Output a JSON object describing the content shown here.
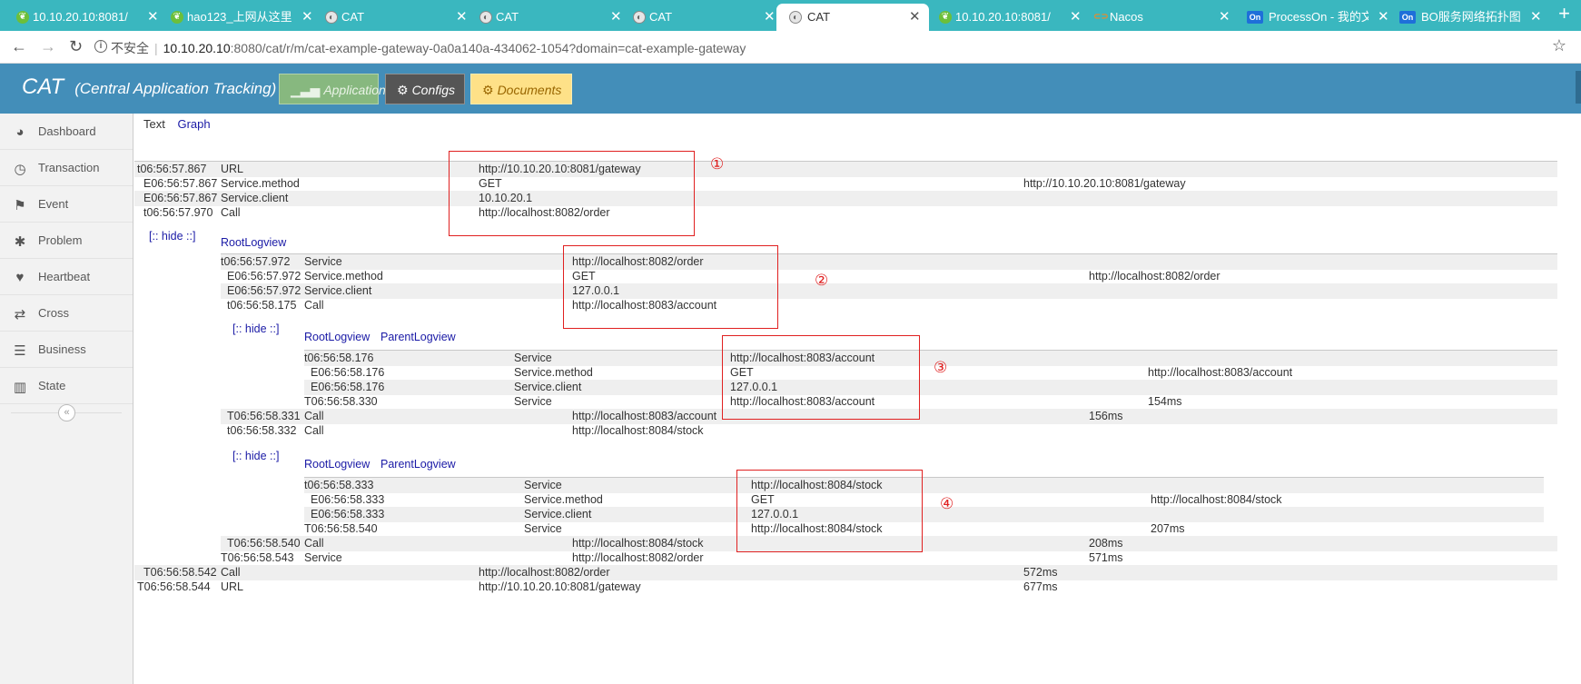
{
  "browser": {
    "tabs": [
      {
        "label": "10.10.20.10:8081/",
        "icon": "leaf-icon"
      },
      {
        "label": "hao123_上网从这里",
        "icon": "leaf-icon"
      },
      {
        "label": "CAT",
        "icon": "cat-icon"
      },
      {
        "label": "CAT",
        "icon": "cat-icon"
      },
      {
        "label": "CAT",
        "icon": "cat-icon"
      },
      {
        "label": "CAT",
        "icon": "cat-icon"
      },
      {
        "label": "10.10.20.10:8081/",
        "icon": "leaf-icon"
      },
      {
        "label": "Nacos",
        "icon": "nacos-icon"
      },
      {
        "label": "ProcessOn - 我的文",
        "icon": "processon-icon"
      },
      {
        "label": "BO服务网络拓扑图",
        "icon": "processon-icon"
      }
    ],
    "active_tab": 5,
    "new_tab": "+",
    "address": {
      "insecure_label": "不安全",
      "separator": "|",
      "host": "10.10.20.10",
      "path": ":8080/cat/r/m/cat-example-gateway-0a0a140a-434062-1054?domain=cat-example-gateway"
    }
  },
  "header": {
    "brand": "CAT",
    "subtitle": "(Central Application Tracking)",
    "buttons": {
      "application": "Application",
      "configs": "Configs",
      "documents": "Documents"
    }
  },
  "sidebar": {
    "items": [
      {
        "label": "Dashboard",
        "icon": "dashboard-icon"
      },
      {
        "label": "Transaction",
        "icon": "clock-icon"
      },
      {
        "label": "Event",
        "icon": "flag-icon"
      },
      {
        "label": "Problem",
        "icon": "bug-icon"
      },
      {
        "label": "Heartbeat",
        "icon": "heart-icon"
      },
      {
        "label": "Cross",
        "icon": "shuffle-icon"
      },
      {
        "label": "Business",
        "icon": "list-icon"
      },
      {
        "label": "State",
        "icon": "bar-chart-icon"
      }
    ],
    "collapse": "«"
  },
  "view_tabs": {
    "text": "Text",
    "graph": "Graph"
  },
  "trace": {
    "l0": [
      {
        "time": "t06:56:57.867",
        "type": "URL",
        "name": "http://10.10.20.10:8081/gateway",
        "extra": ""
      },
      {
        "time": "E06:56:57.867",
        "type": "Service.method",
        "name": "GET",
        "extra": "http://10.10.20.10:8081/gateway"
      },
      {
        "time": "E06:56:57.867",
        "type": "Service.client",
        "name": "10.10.20.1",
        "extra": ""
      },
      {
        "time": "t06:56:57.970",
        "type": "Call",
        "name": "http://localhost:8082/order",
        "extra": ""
      }
    ],
    "hide1": "[:: hide ::]",
    "root1": "RootLogview",
    "l1": [
      {
        "time": "t06:56:57.972",
        "type": "Service",
        "name": "http://localhost:8082/order",
        "extra": ""
      },
      {
        "time": "E06:56:57.972",
        "type": "Service.method",
        "name": "GET",
        "extra": "http://localhost:8082/order"
      },
      {
        "time": "E06:56:57.972",
        "type": "Service.client",
        "name": "127.0.0.1",
        "extra": ""
      },
      {
        "time": "t06:56:58.175",
        "type": "Call",
        "name": "http://localhost:8083/account",
        "extra": ""
      }
    ],
    "hide2": "[:: hide ::]",
    "root2": "RootLogview",
    "parent2": "ParentLogview",
    "l2a": [
      {
        "time": "t06:56:58.176",
        "type": "Service",
        "name": "http://localhost:8083/account",
        "extra": ""
      },
      {
        "time": "E06:56:58.176",
        "type": "Service.method",
        "name": "GET",
        "extra": "http://localhost:8083/account"
      },
      {
        "time": "E06:56:58.176",
        "type": "Service.client",
        "name": "127.0.0.1",
        "extra": ""
      },
      {
        "time": "T06:56:58.330",
        "type": "Service",
        "name": "http://localhost:8083/account",
        "extra": "154ms"
      }
    ],
    "l1b": [
      {
        "time": "T06:56:58.331",
        "type": "Call",
        "name": "http://localhost:8083/account",
        "extra": "156ms"
      },
      {
        "time": "t06:56:58.332",
        "type": "Call",
        "name": "http://localhost:8084/stock",
        "extra": ""
      }
    ],
    "hide3": "[:: hide ::]",
    "root3": "RootLogview",
    "parent3": "ParentLogview",
    "l2b": [
      {
        "time": "t06:56:58.333",
        "type": "Service",
        "name": "http://localhost:8084/stock",
        "extra": ""
      },
      {
        "time": "E06:56:58.333",
        "type": "Service.method",
        "name": "GET",
        "extra": "http://localhost:8084/stock"
      },
      {
        "time": "E06:56:58.333",
        "type": "Service.client",
        "name": "127.0.0.1",
        "extra": ""
      },
      {
        "time": "T06:56:58.540",
        "type": "Service",
        "name": "http://localhost:8084/stock",
        "extra": "207ms"
      }
    ],
    "l1c": [
      {
        "time": "T06:56:58.540",
        "type": "Call",
        "name": "http://localhost:8084/stock",
        "extra": "208ms"
      },
      {
        "time": "T06:56:58.543",
        "type": "Service",
        "name": "http://localhost:8082/order",
        "extra": "571ms"
      }
    ],
    "l0b": [
      {
        "time": "T06:56:58.542",
        "type": "Call",
        "name": "http://localhost:8082/order",
        "extra": "572ms"
      },
      {
        "time": "T06:56:58.544",
        "type": "URL",
        "name": "http://10.10.20.10:8081/gateway",
        "extra": "677ms"
      }
    ]
  },
  "annotations": [
    "①",
    "②",
    "③",
    "④"
  ],
  "colors": {
    "header": "#438eb9",
    "tabstrip": "#3ab7bf",
    "annotation": "#e02020",
    "link": "#1a1aa6"
  }
}
